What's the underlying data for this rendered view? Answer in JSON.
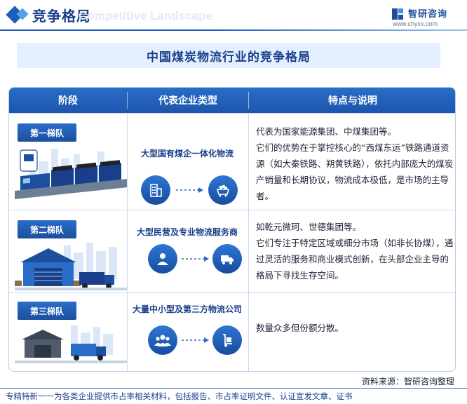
{
  "header": {
    "title": "竞争格局",
    "ghost_text": "Competitive Landscape",
    "logo_name": "智研咨询",
    "logo_url": "www.chyxx.com"
  },
  "main_title": "中国煤炭物流行业的竞争格局",
  "table": {
    "headers": [
      "阶段",
      "代表企业类型",
      "特点与说明"
    ],
    "rows": [
      {
        "tier": "第一梯队",
        "type": "大型国有煤企一体化物流",
        "desc": "代表为国家能源集团、中煤集团等。\n它们的优势在于掌控核心的“西煤东运”铁路通道资源（如大秦铁路、朔黄铁路），依托内部庞大的煤炭产销量和长期协议，物流成本极低，是市场的主导者。",
        "icons": [
          "building-icon",
          "coal-cart-icon"
        ]
      },
      {
        "tier": "第二梯队",
        "type": "大型民营及专业物流服务商",
        "desc": "如乾元微珂、世德集团等。\n它们专注于特定区域或细分市场（如非长协煤），通过灵活的服务和商业模式创新，在头部企业主导的格局下寻找生存空间。",
        "icons": [
          "person-icon",
          "truck-icon"
        ]
      },
      {
        "tier": "第三梯队",
        "type": "大量中小型及第三方物流公司",
        "desc": "数量众多但份额分散。",
        "icons": [
          "group-icon",
          "hand-truck-icon"
        ]
      }
    ]
  },
  "source": "资料来源：智研咨询整理",
  "footer": "专精特新一一为各类企业提供市占率相关材料，包括报告、市占率证明文件、认证宣发文章、证书",
  "colors": {
    "primary": "#1f5fb8",
    "dark": "#1a3f8a",
    "light_band": "#e4efff"
  }
}
